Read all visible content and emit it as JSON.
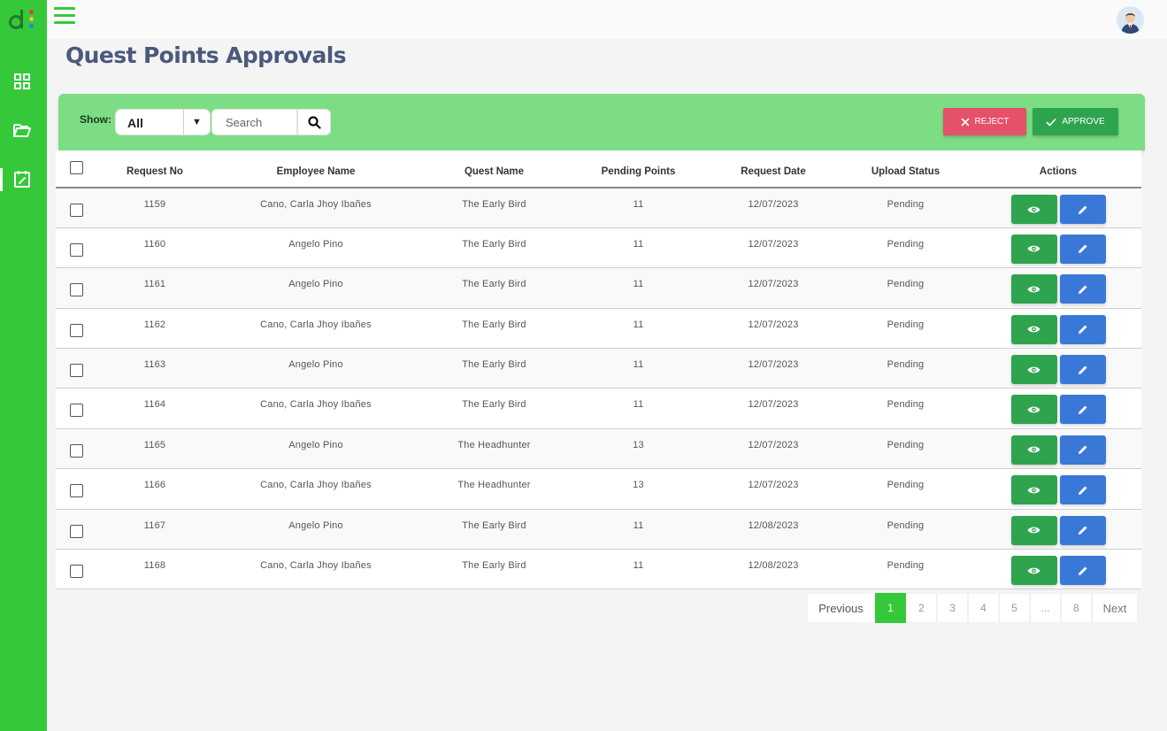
{
  "app": {
    "logo_icon": "app-logo-icon"
  },
  "topbar": {
    "menu_icon": "hamburger-menu-icon",
    "avatar_icon": "user-avatar-icon"
  },
  "sidebar": {
    "items": [
      {
        "icon": "dashboard-grid-icon"
      },
      {
        "icon": "folder-open-icon"
      },
      {
        "icon": "calendar-edit-icon",
        "active": true
      }
    ]
  },
  "page": {
    "title": "Quest Points Approvals"
  },
  "filters": {
    "show_label": "Show:",
    "show_value": "All",
    "search_placeholder": "Search"
  },
  "actions": {
    "reject_label": "REJECT",
    "approve_label": "APPROVE"
  },
  "colors": {
    "sidebar": "#35c93a",
    "filter_bar": "#7ddd85",
    "reject": "#e5506a",
    "approve": "#2ea44f",
    "edit": "#3a78d8",
    "title": "#4a5a7d"
  },
  "table": {
    "headers": [
      "Request No",
      "Employee Name",
      "Quest Name",
      "Pending Points",
      "Request Date",
      "Upload Status",
      "Actions"
    ],
    "rows": [
      {
        "request_no": "1159",
        "employee": "Cano, Carla Jhoy Ibañes",
        "quest": "The Early Bird",
        "points": "11",
        "date": "12/07/2023",
        "status": "Pending"
      },
      {
        "request_no": "1160",
        "employee": "Angelo Pino",
        "quest": "The Early Bird",
        "points": "11",
        "date": "12/07/2023",
        "status": "Pending"
      },
      {
        "request_no": "1161",
        "employee": "Angelo Pino",
        "quest": "The Early Bird",
        "points": "11",
        "date": "12/07/2023",
        "status": "Pending"
      },
      {
        "request_no": "1162",
        "employee": "Cano, Carla Jhoy Ibañes",
        "quest": "The Early Bird",
        "points": "11",
        "date": "12/07/2023",
        "status": "Pending"
      },
      {
        "request_no": "1163",
        "employee": "Angelo Pino",
        "quest": "The Early Bird",
        "points": "11",
        "date": "12/07/2023",
        "status": "Pending"
      },
      {
        "request_no": "1164",
        "employee": "Cano, Carla Jhoy Ibañes",
        "quest": "The Early Bird",
        "points": "11",
        "date": "12/07/2023",
        "status": "Pending"
      },
      {
        "request_no": "1165",
        "employee": "Angelo Pino",
        "quest": "The Headhunter",
        "points": "13",
        "date": "12/07/2023",
        "status": "Pending"
      },
      {
        "request_no": "1166",
        "employee": "Cano, Carla Jhoy Ibañes",
        "quest": "The Headhunter",
        "points": "13",
        "date": "12/07/2023",
        "status": "Pending"
      },
      {
        "request_no": "1167",
        "employee": "Angelo Pino",
        "quest": "The Early Bird",
        "points": "11",
        "date": "12/08/2023",
        "status": "Pending"
      },
      {
        "request_no": "1168",
        "employee": "Cano, Carla Jhoy Ibañes",
        "quest": "The Early Bird",
        "points": "11",
        "date": "12/08/2023",
        "status": "Pending"
      }
    ]
  },
  "pagination": {
    "previous": "Previous",
    "next": "Next",
    "pages": [
      "1",
      "2",
      "3",
      "4",
      "5",
      "...",
      "8"
    ],
    "current": "1"
  }
}
